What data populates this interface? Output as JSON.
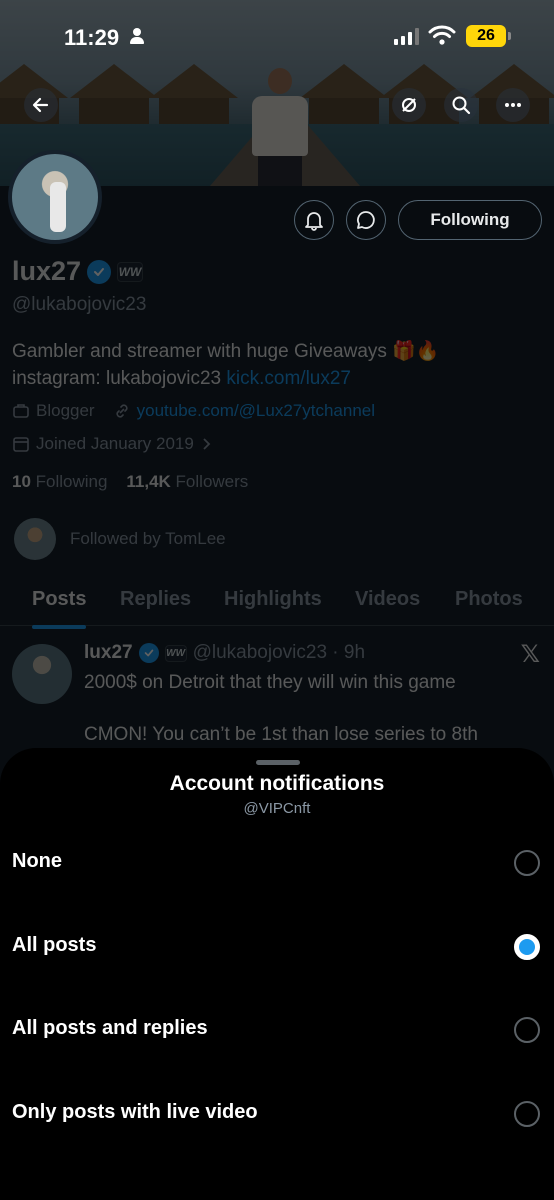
{
  "status_bar": {
    "time": "11:29",
    "battery": "26"
  },
  "profile": {
    "name": "lux27",
    "handle": "@lukabojovic23",
    "affiliate_badge": "WW",
    "following_button": "Following",
    "bio_line1": "Gambler and streamer with huge Giveaways 🎁🔥",
    "bio_line2_prefix": "instagram: lukabojovic23 ",
    "bio_link": "kick.com/lux27",
    "category": "Blogger",
    "website": "youtube.com/@Lux27ytchannel",
    "joined": "Joined January 2019",
    "following_count": "10",
    "following_label": "Following",
    "followers_count": "11,4K",
    "followers_label": "Followers",
    "followed_by": "Followed by TomLee"
  },
  "tabs": [
    "Posts",
    "Replies",
    "Highlights",
    "Videos",
    "Photos"
  ],
  "post": {
    "name": "lux27",
    "handle_time": "@lukabojovic23 · 9h",
    "line1": "2000$ on Detroit that they will win this game",
    "line2": "CMON! You can’t be 1st than lose series to 8th"
  },
  "sheet": {
    "title": "Account notifications",
    "subtitle": "@VIPCnft",
    "options": [
      {
        "label": "None",
        "selected": false
      },
      {
        "label": "All posts",
        "selected": true
      },
      {
        "label": "All posts and replies",
        "selected": false
      },
      {
        "label": "Only posts with live video",
        "selected": false
      }
    ]
  },
  "colors": {
    "accent": "#1d9bf0",
    "background": "#15202b",
    "sheet": "#000000"
  }
}
